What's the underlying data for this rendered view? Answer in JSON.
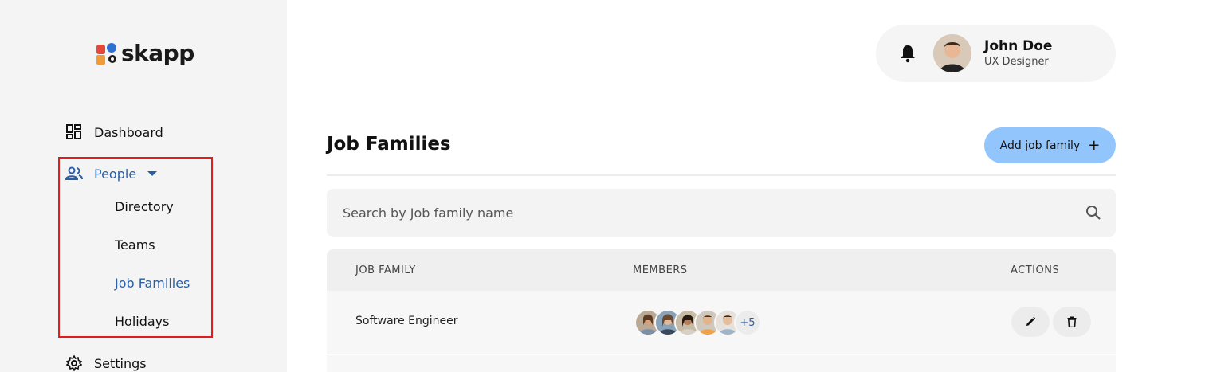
{
  "brand": {
    "name": "skapp"
  },
  "sidebar": {
    "dashboard_label": "Dashboard",
    "people_label": "People",
    "sub_items": [
      "Directory",
      "Teams",
      "Job Families",
      "Holidays"
    ],
    "settings_label": "Settings"
  },
  "user": {
    "name": "John Doe",
    "role": "UX Designer"
  },
  "page": {
    "title": "Job Families",
    "add_button_label": "Add job family",
    "add_button_icon": "+"
  },
  "search": {
    "placeholder": "Search by Job family name"
  },
  "table": {
    "headers": {
      "job_family": "JOB FAMILY",
      "members": "MEMBERS",
      "actions": "ACTIONS"
    },
    "rows": [
      {
        "job_family": "Software Engineer",
        "more_members": "+5"
      }
    ]
  },
  "colors": {
    "accent": "#2a5fa3",
    "button": "#93c5fd",
    "highlight": "#e01c1c"
  }
}
